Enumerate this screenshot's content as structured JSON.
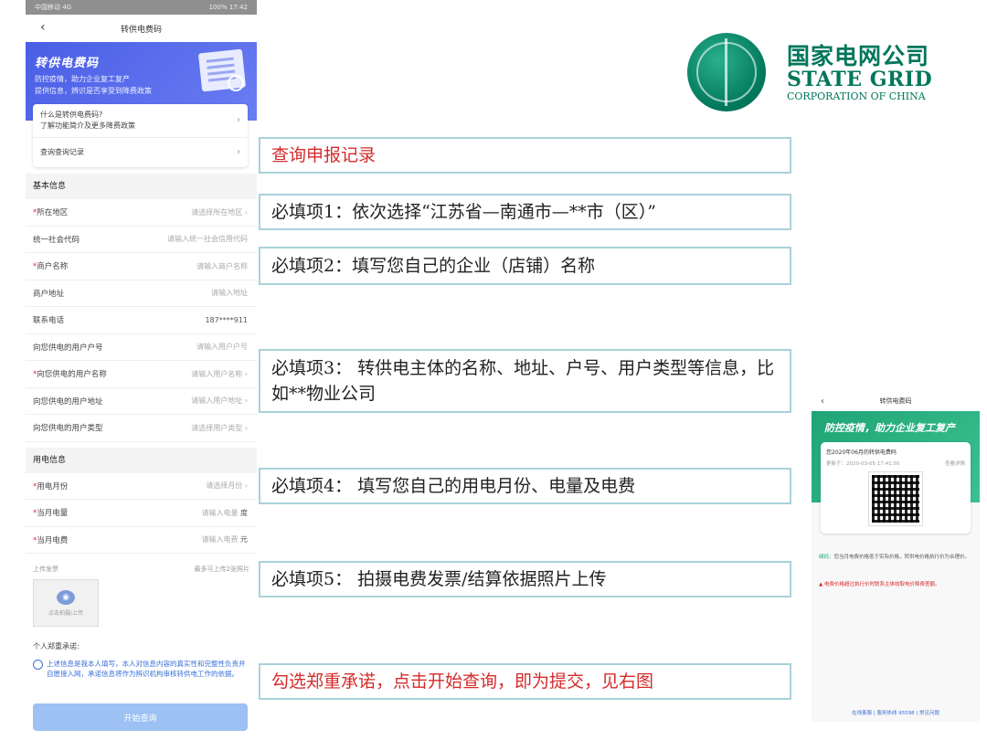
{
  "phone": {
    "status_left": "中国移动 4G",
    "status_right": "100% 17:42",
    "nav_title": "转供电费码",
    "banner": {
      "title": "转供电费码",
      "subtitle1": "防控疫情，助力企业复工复产",
      "subtitle2": "提供信息，辨识是否享受到降费政策"
    },
    "info": [
      {
        "line1": "什么是转供电费码?",
        "line2": "了解功能简介及更多降费政策"
      },
      {
        "line1": "查询查询记录",
        "line2": ""
      }
    ],
    "basic_title": "基本信息",
    "basic_rows": [
      {
        "label": "所在地区",
        "required": true,
        "placeholder": "请选择所在地区",
        "chevron": true
      },
      {
        "label": "统一社会代码",
        "required": false,
        "placeholder": "请输入统一社会信用代码",
        "chevron": false
      },
      {
        "label": "商户名称",
        "required": true,
        "placeholder": "请输入商户名称",
        "chevron": false
      },
      {
        "label": "商户地址",
        "required": false,
        "placeholder": "请输入地址",
        "chevron": false
      },
      {
        "label": "联系电话",
        "required": false,
        "placeholder": "187****911",
        "chevron": false
      },
      {
        "label": "向您供电的用户户号",
        "required": false,
        "placeholder": "请输入用户户号",
        "chevron": false
      },
      {
        "label": "向您供电的用户名称",
        "required": true,
        "placeholder": "请输入用户名称",
        "chevron": true
      },
      {
        "label": "向您供电的用户地址",
        "required": false,
        "placeholder": "请输入用户地址",
        "chevron": true
      },
      {
        "label": "向您供电的用户类型",
        "required": false,
        "placeholder": "请选择用户类型",
        "chevron": true
      }
    ],
    "usage_title": "用电信息",
    "usage_rows": [
      {
        "label": "用电月份",
        "required": true,
        "placeholder": "请选择月份",
        "chevron": true
      },
      {
        "label": "当月电量",
        "required": true,
        "placeholder": "请输入电量",
        "unit": "度"
      },
      {
        "label": "当月电费",
        "required": true,
        "placeholder": "请输入电费",
        "unit": "元"
      }
    ],
    "upload_label": "上传发票",
    "upload_hint": "最多可上传2张照片",
    "upload_box_label": "点击拍摄/上传",
    "promise_title": "个人郑重承诺:",
    "promise_text": "上述信息是我本人填写，本人对信息内容的真实性和完整性负责并自愿接入网，承诺信息将作为辨识机构审核转供电工作的依据。",
    "start_label": "开始查询"
  },
  "logo": {
    "cn": "国家电网公司",
    "en1": "STATE GRID",
    "en2": "CORPORATION OF CHINA"
  },
  "notes": [
    "查询申报记录",
    "必填项1：依次选择“江苏省—南通市—**市（区）”",
    "必填项2：填写您自己的企业（店铺）名称",
    "必填项3：  转供电主体的名称、地址、户号、用户类型等信息，比如**物业公司",
    "必填项4：  填写您自己的用电月份、电量及电费",
    "必填项5：  拍摄电费发票/结算依据照片上传",
    "勾选郑重承诺，点击开始查询，即为提交，见右图"
  ],
  "phone2": {
    "nav_title": "转供电费码",
    "banner_title": "防控疫情，助力企业复工复产",
    "card_title": "您2020年06月的转供电费码",
    "card_time": "更新于：2020-03-05 17:41:50",
    "card_link": "查看详情",
    "tip_label": "绿码：",
    "tip_text": "您当月电费价格低于实际价格，转供电价格执行价为合理价。",
    "warn_text": "电费价格超过执行价时联系主体收取电价降费差额。",
    "footer": "在线客服 | 服务热线 95598 | 常见问题"
  }
}
